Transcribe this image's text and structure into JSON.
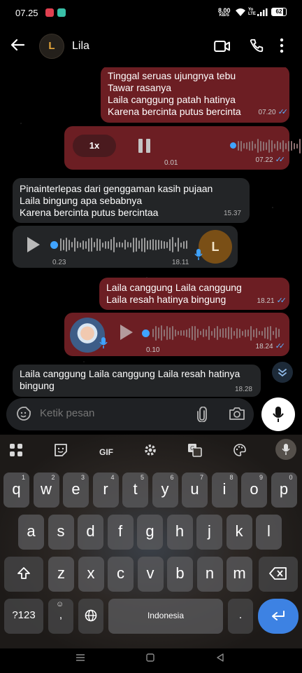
{
  "status": {
    "time": "07.25",
    "net_speed_value": "8.00",
    "net_speed_unit": "KB/S",
    "signal_label": "Yo LTE",
    "battery": "62"
  },
  "header": {
    "avatar_letter": "L",
    "contact_name": "Lila"
  },
  "messages": [
    {
      "type": "text",
      "direction": "outgoing",
      "text": "Tinggal seruas ujungnya tebu\nTawar rasanya\nLaila canggung patah hatinya\nKarena bercinta putus bercinta",
      "time": "07.20",
      "ticks": "✓✓"
    },
    {
      "type": "voice",
      "direction": "outgoing",
      "speed": "1x",
      "elapsed": "0.01",
      "time": "07.22",
      "ticks": "✓✓",
      "progress": 0.02
    },
    {
      "type": "text",
      "direction": "incoming",
      "text": "Pinainterlepas dari genggaman kasih pujaan\nLaila bingung apa sebabnya\nKarena bercinta putus bercintaa",
      "time": "15.37"
    },
    {
      "type": "voice",
      "direction": "incoming",
      "avatar_letter": "L",
      "duration": "0.23",
      "time": "18.11",
      "progress": 0.0
    },
    {
      "type": "text",
      "direction": "outgoing",
      "text": "Laila canggung Laila canggung\nLaila resah hatinya bingung",
      "time": "18.21",
      "ticks": "✓✓"
    },
    {
      "type": "voice",
      "direction": "outgoing",
      "duration": "0.10",
      "time": "18.24",
      "ticks": "✓✓",
      "progress": 0.0
    },
    {
      "type": "text",
      "direction": "incoming",
      "text": "Laila canggung Laila canggung Laila resah hatinya bingung",
      "time": "18.28"
    }
  ],
  "composer": {
    "placeholder": "Ketik pesan"
  },
  "keyboard": {
    "toolbar": [
      "grid-icon",
      "sticker-icon",
      "GIF",
      "settings-icon",
      "translate-icon",
      "palette-icon",
      "mic-icon"
    ],
    "gif_label": "GIF",
    "row1": [
      {
        "key": "q",
        "hint": "1"
      },
      {
        "key": "w",
        "hint": "2"
      },
      {
        "key": "e",
        "hint": "3"
      },
      {
        "key": "r",
        "hint": "4"
      },
      {
        "key": "t",
        "hint": "5"
      },
      {
        "key": "y",
        "hint": "6"
      },
      {
        "key": "u",
        "hint": "7"
      },
      {
        "key": "i",
        "hint": "8"
      },
      {
        "key": "o",
        "hint": "9"
      },
      {
        "key": "p",
        "hint": "0"
      }
    ],
    "row2": [
      "a",
      "s",
      "d",
      "f",
      "g",
      "h",
      "j",
      "k",
      "l"
    ],
    "row3": [
      "z",
      "x",
      "c",
      "v",
      "b",
      "n",
      "m"
    ],
    "symbols_label": "?123",
    "comma_label": ",",
    "period_label": ".",
    "space_label": "Indonesia"
  },
  "colors": {
    "outgoing_bubble": "#6c1e23",
    "incoming_bubble": "#232527",
    "read_ticks": "#5ab0ff",
    "enter_key": "#3d82e3",
    "voice_dot": "#3fa3ff"
  }
}
